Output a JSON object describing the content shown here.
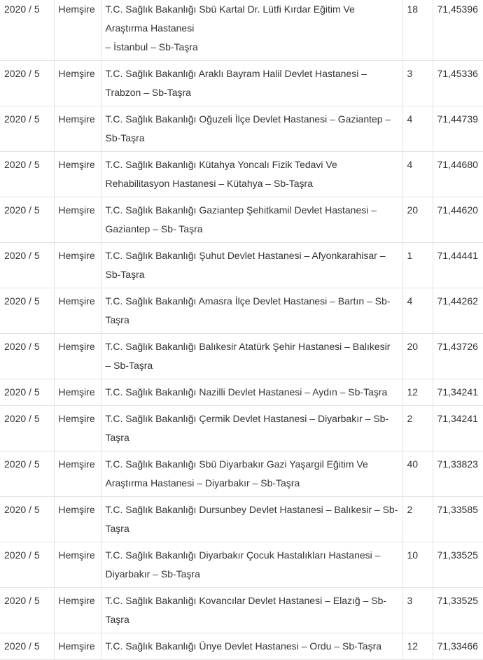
{
  "rows": [
    {
      "year": "2020 / 5",
      "title": "Hemşire",
      "institution": "T.C. Sağlık Bakanlığı Sbü Kartal Dr. Lütfi Kırdar Eğitim Ve Araştırma Hastanesi",
      "institution_suffix": "– İstanbul – Sb-Taşra",
      "quota": "18",
      "score": "71,45396"
    },
    {
      "year": "2020 / 5",
      "title": "Hemşire",
      "institution": "T.C. Sağlık Bakanlığı Araklı Bayram Halil Devlet Hastanesi – Trabzon – Sb-Taşra",
      "quota": "3",
      "score": "71,45336"
    },
    {
      "year": "2020 / 5",
      "title": "Hemşire",
      "institution": "T.C. Sağlık Bakanlığı Oğuzeli İlçe Devlet Hastanesi – Gaziantep – Sb-Taşra",
      "quota": "4",
      "score": "71,44739"
    },
    {
      "year": "2020 / 5",
      "title": "Hemşire",
      "institution": "T.C. Sağlık Bakanlığı Kütahya Yoncalı Fizik Tedavi Ve Rehabilitasyon Hastanesi – Kütahya – Sb-Taşra",
      "quota": "4",
      "score": "71,44680"
    },
    {
      "year": "2020 / 5",
      "title": "Hemşire",
      "institution": "T.C. Sağlık Bakanlığı Gaziantep Şehitkamil Devlet Hastanesi – Gaziantep – Sb- Taşra",
      "quota": "20",
      "score": "71,44620"
    },
    {
      "year": "2020 / 5",
      "title": "Hemşire",
      "institution": "T.C. Sağlık Bakanlığı Şuhut Devlet Hastanesi – Afyonkarahisar – Sb-Taşra",
      "quota": "1",
      "score": "71,44441"
    },
    {
      "year": "2020 / 5",
      "title": "Hemşire",
      "institution": "T.C. Sağlık Bakanlığı Amasra İlçe Devlet Hastanesi – Bartın – Sb-Taşra",
      "quota": "4",
      "score": "71,44262"
    },
    {
      "year": "2020 / 5",
      "title": "Hemşire",
      "institution": "T.C. Sağlık Bakanlığı Balıkesir Atatürk Şehir Hastanesi – Balıkesir – Sb-Taşra",
      "quota": "20",
      "score": "71,43726"
    },
    {
      "year": "2020 / 5",
      "title": "Hemşire",
      "institution": "T.C. Sağlık Bakanlığı Nazilli Devlet Hastanesi – Aydın – Sb-Taşra",
      "quota": "12",
      "score": "71,34241"
    },
    {
      "year": "2020 / 5",
      "title": "Hemşire",
      "institution": "T.C. Sağlık Bakanlığı Çermik Devlet Hastanesi – Diyarbakır – Sb-Taşra",
      "quota": "2",
      "score": "71,34241"
    },
    {
      "year": "2020 / 5",
      "title": "Hemşire",
      "institution": "T.C. Sağlık Bakanlığı Sbü Diyarbakır Gazi Yaşargil Eğitim Ve Araştırma Hastanesi – Diyarbakır – Sb-Taşra",
      "quota": "40",
      "score": "71,33823"
    },
    {
      "year": "2020 / 5",
      "title": "Hemşire",
      "institution": "T.C. Sağlık Bakanlığı Dursunbey Devlet Hastanesi – Balıkesir – Sb-Taşra",
      "quota": "2",
      "score": "71,33585"
    },
    {
      "year": "2020 / 5",
      "title": "Hemşire",
      "institution": "T.C. Sağlık Bakanlığı Diyarbakır Çocuk Hastalıkları Hastanesi – Diyarbakır – Sb-Taşra",
      "quota": "10",
      "score": "71,33525"
    },
    {
      "year": "2020 / 5",
      "title": "Hemşire",
      "institution": "T.C. Sağlık Bakanlığı Kovancılar Devlet Hastanesi – Elazığ – Sb-Taşra",
      "quota": "3",
      "score": "71,33525"
    },
    {
      "year": "2020 / 5",
      "title": "Hemşire",
      "institution": "T.C. Sağlık Bakanlığı Ünye Devlet Hastanesi – Ordu – Sb-Taşra",
      "quota": "12",
      "score": "71,33466"
    }
  ]
}
